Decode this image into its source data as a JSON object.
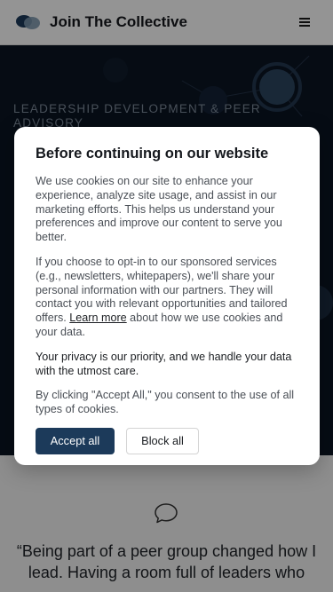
{
  "header": {
    "brand": "Join The Collective",
    "logo_icon": "collective-logo-icon",
    "menu_icon": "hamburger-menu-icon"
  },
  "hero": {
    "eyebrow": "LEADERSHIP DEVELOPMENT & PEER ADVISORY"
  },
  "testimonial": {
    "icon": "speech-bubble-icon",
    "text": "“Being part of a peer group changed how I lead. Having a room full of leaders who"
  },
  "cookie_modal": {
    "title": "Before continuing on our website",
    "para1": "We use cookies on our site to enhance your experience, analyze site usage, and assist in our marketing efforts. This helps us understand your preferences and improve our content to serve you better.",
    "para2_before": "If you choose to opt-in to our sponsored services (e.g., newsletters, whitepapers), we'll share your personal information with our partners. They will contact you with relevant opportunities and tailored offers. ",
    "learn_more": "Learn more",
    "para2_after": " about how we use cookies and your data.",
    "para3": "Your privacy is our priority, and we handle your data with the utmost care.",
    "para4": "By clicking \"Accept All,\" you consent to the use of all types of cookies.",
    "accept_label": "Accept all",
    "block_label": "Block all"
  },
  "colors": {
    "accent": "#1c3a5a",
    "hero_bg": "#0c1624"
  }
}
